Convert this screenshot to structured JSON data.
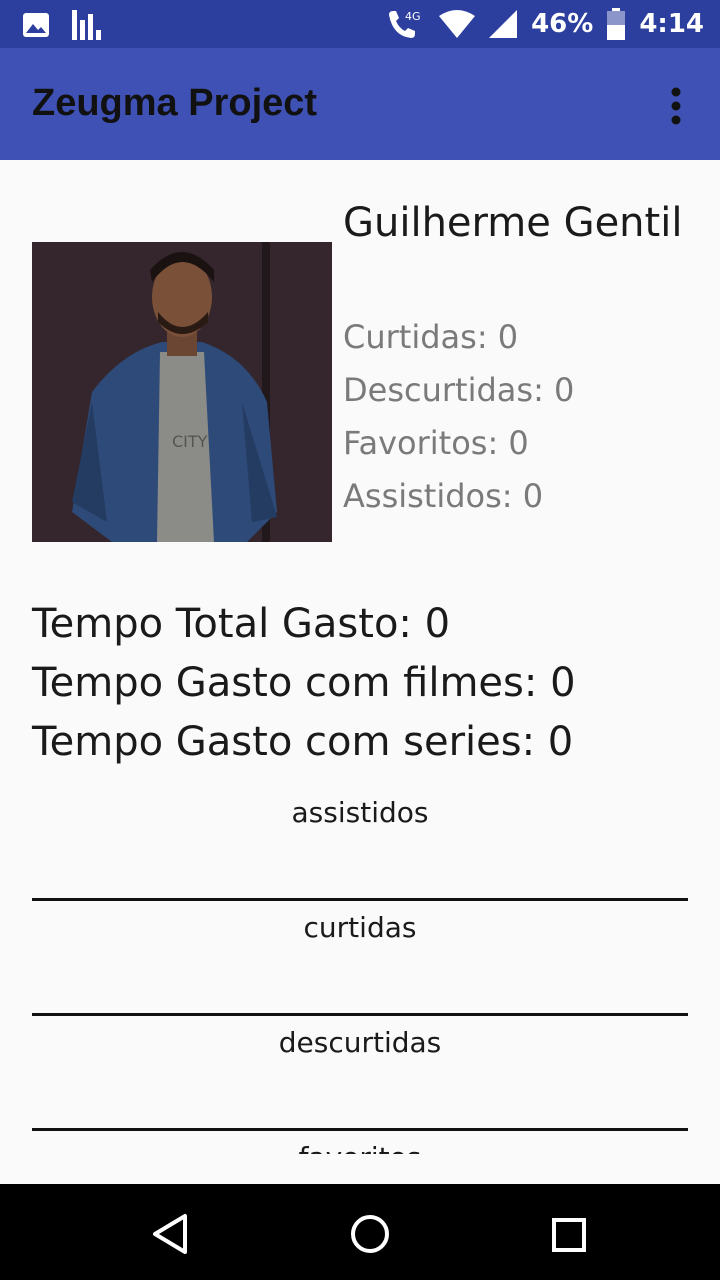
{
  "status_bar": {
    "icons_left": [
      "image-icon",
      "signal-bars-icon"
    ],
    "network_label": "4G",
    "battery_percent": "46%",
    "time": "4:14"
  },
  "app_bar": {
    "title": "Zeugma Project",
    "menu_icon": "more-vert-icon"
  },
  "profile": {
    "name": "Guilherme Gentil",
    "stats": [
      {
        "label": "Curtidas: 0"
      },
      {
        "label": "Descurtidas: 0"
      },
      {
        "label": "Favoritos: 0"
      },
      {
        "label": "Assistidos: 0"
      }
    ],
    "time_lines": [
      "Tempo Total Gasto: 0",
      "Tempo Gasto com filmes: 0",
      "Tempo Gasto com series: 0"
    ]
  },
  "tabs": [
    {
      "label": "assistidos"
    },
    {
      "label": "curtidas"
    },
    {
      "label": "descurtidas"
    },
    {
      "label": "favoritos"
    }
  ],
  "nav_bar": {
    "buttons": [
      "back-icon",
      "home-icon",
      "recents-icon"
    ]
  }
}
